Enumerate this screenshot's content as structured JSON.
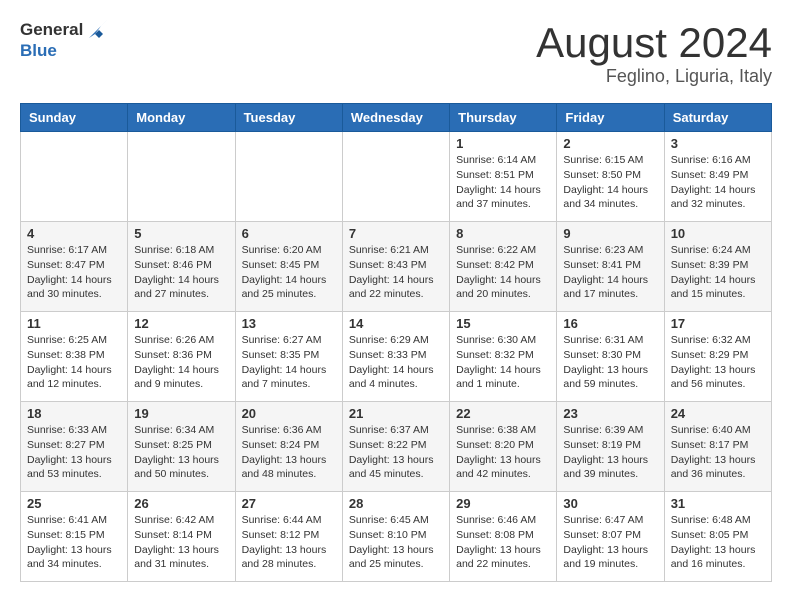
{
  "logo": {
    "general": "General",
    "blue": "Blue"
  },
  "title": "August 2024",
  "location": "Feglino, Liguria, Italy",
  "days_of_week": [
    "Sunday",
    "Monday",
    "Tuesday",
    "Wednesday",
    "Thursday",
    "Friday",
    "Saturday"
  ],
  "weeks": [
    [
      {
        "day": "",
        "info": ""
      },
      {
        "day": "",
        "info": ""
      },
      {
        "day": "",
        "info": ""
      },
      {
        "day": "",
        "info": ""
      },
      {
        "day": "1",
        "info": "Sunrise: 6:14 AM\nSunset: 8:51 PM\nDaylight: 14 hours and 37 minutes."
      },
      {
        "day": "2",
        "info": "Sunrise: 6:15 AM\nSunset: 8:50 PM\nDaylight: 14 hours and 34 minutes."
      },
      {
        "day": "3",
        "info": "Sunrise: 6:16 AM\nSunset: 8:49 PM\nDaylight: 14 hours and 32 minutes."
      }
    ],
    [
      {
        "day": "4",
        "info": "Sunrise: 6:17 AM\nSunset: 8:47 PM\nDaylight: 14 hours and 30 minutes."
      },
      {
        "day": "5",
        "info": "Sunrise: 6:18 AM\nSunset: 8:46 PM\nDaylight: 14 hours and 27 minutes."
      },
      {
        "day": "6",
        "info": "Sunrise: 6:20 AM\nSunset: 8:45 PM\nDaylight: 14 hours and 25 minutes."
      },
      {
        "day": "7",
        "info": "Sunrise: 6:21 AM\nSunset: 8:43 PM\nDaylight: 14 hours and 22 minutes."
      },
      {
        "day": "8",
        "info": "Sunrise: 6:22 AM\nSunset: 8:42 PM\nDaylight: 14 hours and 20 minutes."
      },
      {
        "day": "9",
        "info": "Sunrise: 6:23 AM\nSunset: 8:41 PM\nDaylight: 14 hours and 17 minutes."
      },
      {
        "day": "10",
        "info": "Sunrise: 6:24 AM\nSunset: 8:39 PM\nDaylight: 14 hours and 15 minutes."
      }
    ],
    [
      {
        "day": "11",
        "info": "Sunrise: 6:25 AM\nSunset: 8:38 PM\nDaylight: 14 hours and 12 minutes."
      },
      {
        "day": "12",
        "info": "Sunrise: 6:26 AM\nSunset: 8:36 PM\nDaylight: 14 hours and 9 minutes."
      },
      {
        "day": "13",
        "info": "Sunrise: 6:27 AM\nSunset: 8:35 PM\nDaylight: 14 hours and 7 minutes."
      },
      {
        "day": "14",
        "info": "Sunrise: 6:29 AM\nSunset: 8:33 PM\nDaylight: 14 hours and 4 minutes."
      },
      {
        "day": "15",
        "info": "Sunrise: 6:30 AM\nSunset: 8:32 PM\nDaylight: 14 hours and 1 minute."
      },
      {
        "day": "16",
        "info": "Sunrise: 6:31 AM\nSunset: 8:30 PM\nDaylight: 13 hours and 59 minutes."
      },
      {
        "day": "17",
        "info": "Sunrise: 6:32 AM\nSunset: 8:29 PM\nDaylight: 13 hours and 56 minutes."
      }
    ],
    [
      {
        "day": "18",
        "info": "Sunrise: 6:33 AM\nSunset: 8:27 PM\nDaylight: 13 hours and 53 minutes."
      },
      {
        "day": "19",
        "info": "Sunrise: 6:34 AM\nSunset: 8:25 PM\nDaylight: 13 hours and 50 minutes."
      },
      {
        "day": "20",
        "info": "Sunrise: 6:36 AM\nSunset: 8:24 PM\nDaylight: 13 hours and 48 minutes."
      },
      {
        "day": "21",
        "info": "Sunrise: 6:37 AM\nSunset: 8:22 PM\nDaylight: 13 hours and 45 minutes."
      },
      {
        "day": "22",
        "info": "Sunrise: 6:38 AM\nSunset: 8:20 PM\nDaylight: 13 hours and 42 minutes."
      },
      {
        "day": "23",
        "info": "Sunrise: 6:39 AM\nSunset: 8:19 PM\nDaylight: 13 hours and 39 minutes."
      },
      {
        "day": "24",
        "info": "Sunrise: 6:40 AM\nSunset: 8:17 PM\nDaylight: 13 hours and 36 minutes."
      }
    ],
    [
      {
        "day": "25",
        "info": "Sunrise: 6:41 AM\nSunset: 8:15 PM\nDaylight: 13 hours and 34 minutes."
      },
      {
        "day": "26",
        "info": "Sunrise: 6:42 AM\nSunset: 8:14 PM\nDaylight: 13 hours and 31 minutes."
      },
      {
        "day": "27",
        "info": "Sunrise: 6:44 AM\nSunset: 8:12 PM\nDaylight: 13 hours and 28 minutes."
      },
      {
        "day": "28",
        "info": "Sunrise: 6:45 AM\nSunset: 8:10 PM\nDaylight: 13 hours and 25 minutes."
      },
      {
        "day": "29",
        "info": "Sunrise: 6:46 AM\nSunset: 8:08 PM\nDaylight: 13 hours and 22 minutes."
      },
      {
        "day": "30",
        "info": "Sunrise: 6:47 AM\nSunset: 8:07 PM\nDaylight: 13 hours and 19 minutes."
      },
      {
        "day": "31",
        "info": "Sunrise: 6:48 AM\nSunset: 8:05 PM\nDaylight: 13 hours and 16 minutes."
      }
    ]
  ]
}
